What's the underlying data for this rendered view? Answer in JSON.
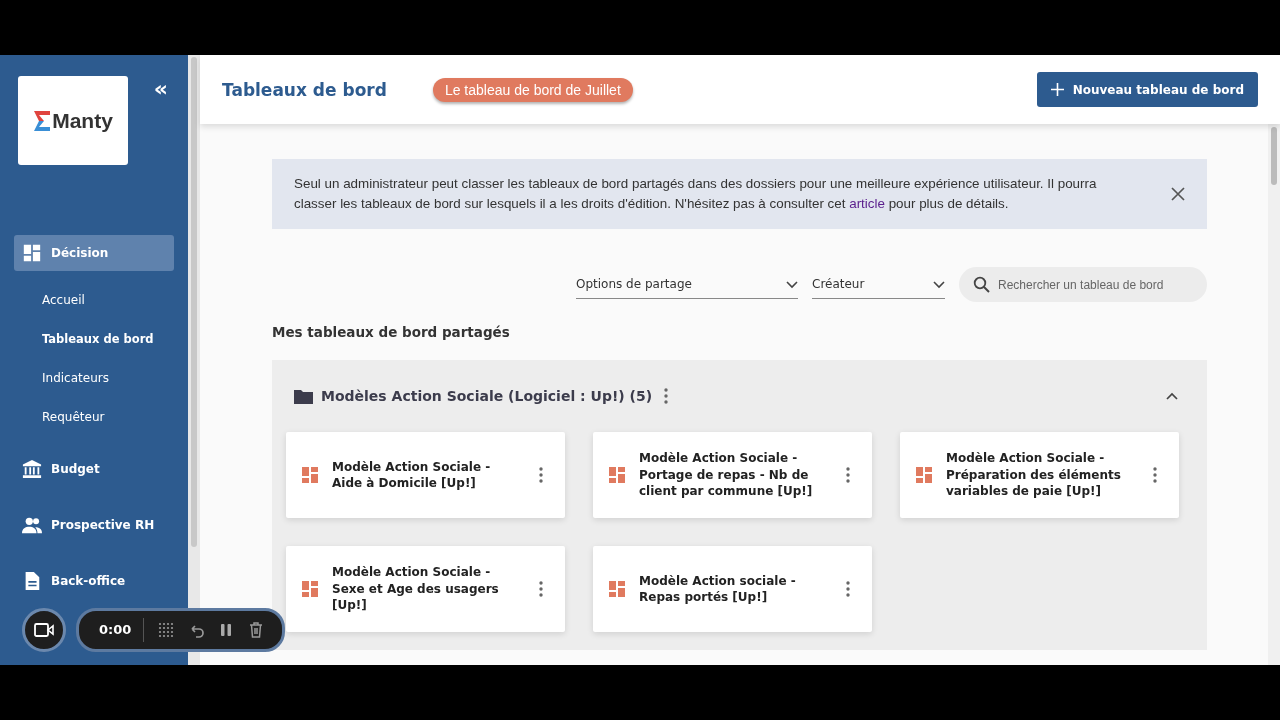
{
  "sidebar": {
    "logo": {
      "text": "Manty"
    },
    "collapse_icon": "«",
    "items": [
      {
        "label": "Décision",
        "selected": true,
        "children": [
          {
            "label": "Accueil",
            "selected": false
          },
          {
            "label": "Tableaux de bord",
            "selected": true
          },
          {
            "label": "Indicateurs",
            "selected": false
          },
          {
            "label": "Requêteur",
            "selected": false
          }
        ]
      },
      {
        "label": "Budget",
        "selected": false
      },
      {
        "label": "Prospective RH",
        "selected": false
      },
      {
        "label": "Back-office",
        "selected": false
      }
    ]
  },
  "header": {
    "title": "Tableaux de bord",
    "badge": "Le tableau de bord de Juillet",
    "new_button": "Nouveau tableau de bord"
  },
  "notice": {
    "text_before": "Seul un administrateur peut classer les tableaux de bord partagés dans des dossiers pour une meilleure expérience utilisateur. Il pourra classer les tableaux de bord sur lesquels il a les droits d'édition. N'hésitez pas à consulter cet",
    "link": "article",
    "text_after": "pour plus de détails."
  },
  "filters": [
    {
      "label": "Options de partage"
    },
    {
      "label": "Créateur"
    }
  ],
  "search": {
    "placeholder": "Rechercher un tableau de bord"
  },
  "section_title": "Mes tableaux de bord partagés",
  "folder": {
    "title": "Modèles Action Sociale (Logiciel : Up!) (5)",
    "expanded": true,
    "cards": [
      {
        "title": "Modèle Action Sociale - Aide à Domicile [Up!]"
      },
      {
        "title": "Modèle Action Sociale - Portage de repas - Nb de client par commune [Up!]"
      },
      {
        "title": "Modèle Action Sociale - Préparation des éléments variables de paie [Up!]"
      },
      {
        "title": "Modèle Action Sociale - Sexe et Age des usagers [Up!]"
      },
      {
        "title": "Modèle Action sociale - Repas portés [Up!]"
      }
    ]
  },
  "recorder": {
    "time": "0:00"
  }
}
